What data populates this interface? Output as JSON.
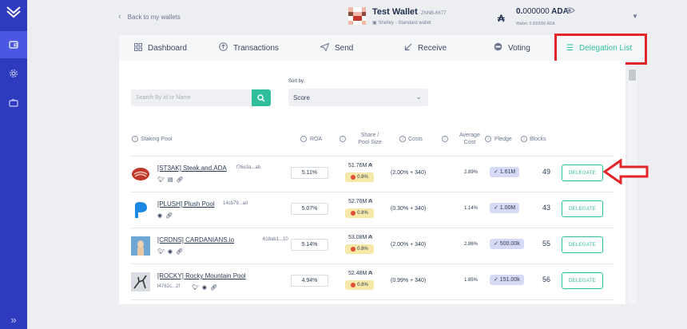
{
  "sidebar": {
    "logo_icon": "chevrons-logo-icon",
    "items": [
      {
        "icon": "wallet-icon",
        "active": true
      },
      {
        "icon": "settings-gear-icon",
        "active": false
      },
      {
        "icon": "paper-wallet-icon",
        "active": false
      }
    ],
    "expand_icon": "double-chevron-right-icon"
  },
  "topbar": {
    "back_label": "Back to my wallets",
    "wallet": {
      "name": "Test Wallet",
      "id": "ZNNB-6677",
      "type": "Shelley - Standard wallet",
      "balance_main": "0.",
      "balance_decimals": "000000",
      "balance_unit": "ADA",
      "sub_balance": "Wallet: 0.000000 ADA"
    }
  },
  "tabs": [
    {
      "label": "Dashboard",
      "icon": "grid-icon",
      "active": false
    },
    {
      "label": "Transactions",
      "icon": "transactions-icon",
      "active": false
    },
    {
      "label": "Send",
      "icon": "send-icon",
      "active": false
    },
    {
      "label": "Receive",
      "icon": "receive-arrow-icon",
      "active": false
    },
    {
      "label": "Voting",
      "icon": "voting-icon",
      "active": false
    },
    {
      "label": "Delegation List",
      "icon": "list-icon",
      "active": true
    }
  ],
  "filters": {
    "search_placeholder": "Search By Id or Name",
    "sort_label": "Sort by:",
    "sort_value": "Score"
  },
  "table": {
    "headers": {
      "pool": "Staking Pool",
      "roa": "ROA",
      "share_line1": "Share /",
      "share_line2": "Pool Size",
      "costs": "Costs",
      "margin_line1": "Average",
      "margin_line2": "Cost",
      "pledge": "Pledge",
      "blocks": "Blocks"
    },
    "delegate_label": "DELEGATE",
    "rows": [
      {
        "ticker_name": "[ST3AK] Steak.and.ADA",
        "hash": "f76e3a...ab",
        "socials": [
          "twitter",
          "telegram",
          "link"
        ],
        "roa": "5.11%",
        "size": "51.76M ₳",
        "saturation": "0.8%",
        "costs": "(2.00% + 340)",
        "margin": "2.89%",
        "pledge": "✓ 1.61M",
        "blocks": "49"
      },
      {
        "ticker_name": "[PLUSH] Plush Pool",
        "hash": "14cb79...a0",
        "socials": [
          "telegram",
          "link"
        ],
        "roa": "5.07%",
        "size": "52.76M ₳",
        "saturation": "0.8%",
        "costs": "(0.30% + 340)",
        "margin": "1.14%",
        "pledge": "✓ 1.00M",
        "blocks": "43"
      },
      {
        "ticker_name": "[CRDNS] CARDANIANS.io",
        "hash": "618ab1...10",
        "socials": [
          "twitter",
          "telegram",
          "link"
        ],
        "roa": "5.14%",
        "size": "53.08M ₳",
        "saturation": "0.8%",
        "costs": "(2.00% + 340)",
        "margin": "2.86%",
        "pledge": "✓ 500.00k",
        "blocks": "55"
      },
      {
        "ticker_name": "[ROCKY] Rocky Mountain Pool",
        "hash": "f4762c...2f",
        "socials": [
          "twitter",
          "telegram",
          "link"
        ],
        "roa": "4.94%",
        "size": "52.48M ₳",
        "saturation": "0.8%",
        "costs": "(0.99% + 340)",
        "margin": "1.85%",
        "pledge": "✓ 151.00k",
        "blocks": "56"
      }
    ]
  },
  "colors": {
    "sidebar": "#2f3bbf",
    "accent": "#2fbf9c",
    "annotation_red": "#e3242b"
  }
}
